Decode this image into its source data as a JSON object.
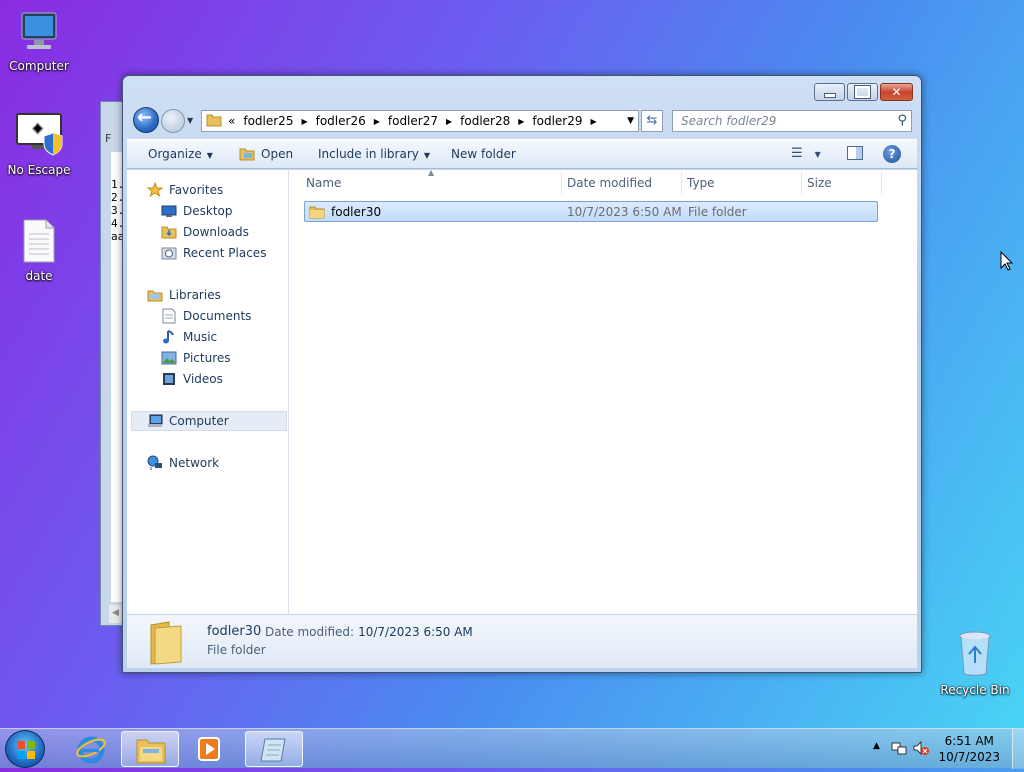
{
  "desktop": {
    "icons": [
      {
        "label": "Computer"
      },
      {
        "label": "No Escape"
      },
      {
        "label": "date"
      },
      {
        "label": "Recycle Bin"
      }
    ]
  },
  "background_window": {
    "menu_letter": "F",
    "lines": [
      "1.",
      "2.",
      "3.",
      "4.",
      "aa"
    ]
  },
  "window": {
    "address": {
      "overflow": "«",
      "crumbs": [
        "fodler25",
        "fodler26",
        "fodler27",
        "fodler28",
        "fodler29"
      ]
    },
    "search_placeholder": "Search fodler29",
    "toolbar": {
      "organize": "Organize",
      "open": "Open",
      "include_in_library": "Include in library",
      "new_folder": "New folder"
    },
    "nav": {
      "favorites": "Favorites",
      "desktop": "Desktop",
      "downloads": "Downloads",
      "recent_places": "Recent Places",
      "libraries": "Libraries",
      "documents": "Documents",
      "music": "Music",
      "pictures": "Pictures",
      "videos": "Videos",
      "computer": "Computer",
      "network": "Network"
    },
    "columns": {
      "name": "Name",
      "date_modified": "Date modified",
      "type": "Type",
      "size": "Size"
    },
    "files": [
      {
        "name": "fodler30",
        "date_modified": "10/7/2023 6:50 AM",
        "type": "File folder",
        "size": ""
      }
    ],
    "details": {
      "name": "fodler30",
      "date_label": "Date modified:",
      "date_value": "10/7/2023 6:50 AM",
      "type": "File folder"
    }
  },
  "taskbar": {
    "time": "6:51 AM",
    "date": "10/7/2023"
  },
  "colors": {
    "selection": "#c1dcfc",
    "accent": "#1e395b"
  }
}
